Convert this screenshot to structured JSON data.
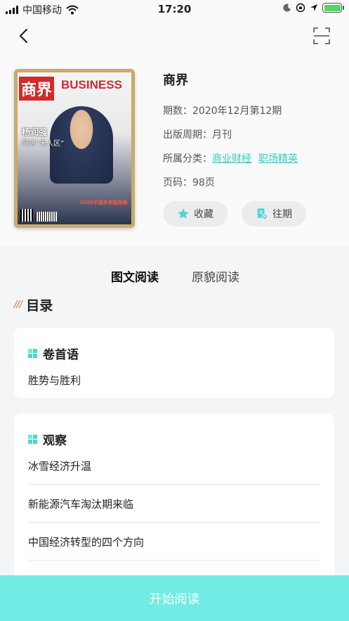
{
  "status_bar": {
    "carrier": "中国移动",
    "time": "17:20"
  },
  "magazine": {
    "title": "商界",
    "issue_label": "期数：",
    "issue_value": "2020年12月第12期",
    "cycle_label": "出版周期：",
    "cycle_value": "月刊",
    "category_label": "所属分类：",
    "categories": [
      "商业财经",
      "职场精英"
    ],
    "pages_label": "页码：",
    "pages_value": "98页"
  },
  "cover": {
    "logo": "商界",
    "brand": "BUSINESS",
    "person_name": "杨润强",
    "headline": "闯进“无人区”",
    "banner": "2020中国未来独角兽"
  },
  "actions": {
    "favorite": "收藏",
    "past_issues": "往期"
  },
  "tabs": {
    "active": "图文阅读",
    "other": "原貌阅读"
  },
  "toc": {
    "heading": "目录",
    "sections": [
      {
        "title": "卷首语",
        "items": [
          "胜势与胜利"
        ]
      },
      {
        "title": "观察",
        "items": [
          "冰雪经济升温",
          "新能源汽车淘汰期来临",
          "中国经济转型的四个方向"
        ]
      }
    ]
  },
  "start_button": "开始阅读",
  "colors": {
    "accent": "#70ece4",
    "link": "#39c6c6",
    "toc_slashes": "#f08a5a"
  }
}
